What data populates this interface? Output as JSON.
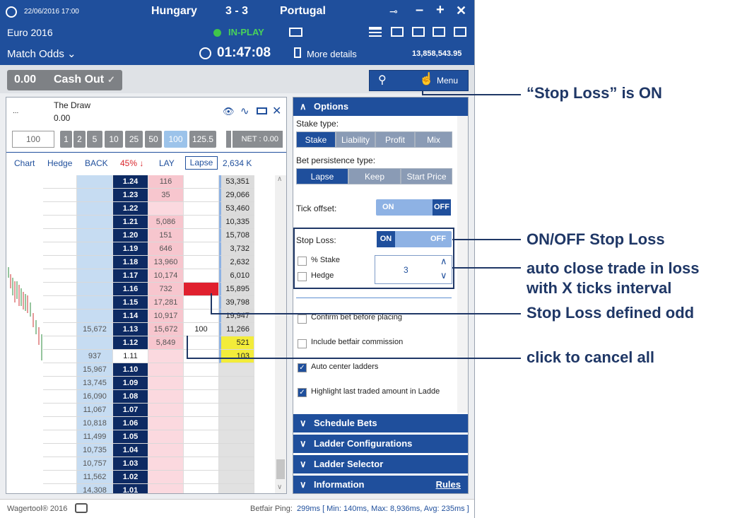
{
  "header": {
    "datetime": "22/06/2016 17:00",
    "home": "Hungary",
    "score": "3 - 3",
    "away": "Portugal",
    "competition": "Euro 2016",
    "status": "IN-PLAY",
    "market": "Match Odds",
    "clock": "01:47:08",
    "more_details": "More details",
    "matched": "13,858,543.95"
  },
  "cashout": {
    "value": "0.00",
    "label": "Cash Out",
    "check": "✓"
  },
  "menu": {
    "label": "Menu"
  },
  "runner": {
    "prefix": "...",
    "name": "The Draw",
    "pl": "0.00",
    "stake_input": "100",
    "stakes": [
      "1",
      "2",
      "5",
      "10",
      "25",
      "50",
      "100",
      "125.5"
    ],
    "net": "NET : 0.00"
  },
  "columns": {
    "chart": "Chart",
    "hedge": "Hedge",
    "back": "BACK",
    "pct": "45% ↓",
    "lay": "LAY",
    "lapse": "Lapse",
    "volume": "2,634 K"
  },
  "ladder": [
    {
      "price": "1.24",
      "layv": "116",
      "traded": "53,351"
    },
    {
      "price": "1.23",
      "layv": "35",
      "traded": "29,066"
    },
    {
      "price": "1.22",
      "layv": "",
      "traded": "53,460"
    },
    {
      "price": "1.21",
      "layv": "5,086",
      "traded": "10,335"
    },
    {
      "price": "1.20",
      "layv": "151",
      "traded": "15,708"
    },
    {
      "price": "1.19",
      "layv": "646",
      "traded": "3,732"
    },
    {
      "price": "1.18",
      "layv": "13,960",
      "traded": "2,632"
    },
    {
      "price": "1.17",
      "layv": "10,174",
      "traded": "6,010"
    },
    {
      "price": "1.16",
      "layv": "732",
      "traded": "15,895"
    },
    {
      "price": "1.15",
      "layv": "17,281",
      "traded": "39,798"
    },
    {
      "price": "1.14",
      "layv": "10,917",
      "traded": "19,947"
    },
    {
      "price": "1.13",
      "layv": "15,672",
      "backv": "15,672",
      "myorder": "100",
      "traded": "11,266"
    },
    {
      "price": "1.12",
      "layv": "5,849",
      "traded": "521"
    },
    {
      "price": "1.11",
      "backv": "937",
      "traded": "103"
    },
    {
      "price": "1.10",
      "backv": "15,967"
    },
    {
      "price": "1.09",
      "backv": "13,745"
    },
    {
      "price": "1.08",
      "backv": "16,090"
    },
    {
      "price": "1.07",
      "backv": "11,067"
    },
    {
      "price": "1.06",
      "backv": "10,818"
    },
    {
      "price": "1.05",
      "backv": "11,499"
    },
    {
      "price": "1.04",
      "backv": "10,735"
    },
    {
      "price": "1.03",
      "backv": "10,757"
    },
    {
      "price": "1.02",
      "backv": "11,562"
    },
    {
      "price": "1.01",
      "backv": "14,308"
    }
  ],
  "options": {
    "title": "Options",
    "stake_type": "Stake type:",
    "stake_types": [
      "Stake",
      "Liability",
      "Profit",
      "Mix"
    ],
    "persistence": "Bet persistence type:",
    "persistence_types": [
      "Lapse",
      "Keep",
      "Start Price"
    ],
    "tick_offset": "Tick offset:",
    "on": "ON",
    "off": "OFF",
    "stop_loss": "Stop Loss:",
    "pct_stake": "% Stake",
    "hedge": "Hedge",
    "ticks": "3",
    "confirm": "Confirm bet before placing",
    "commission": "Include betfair commission",
    "autocenter": "Auto center ladders",
    "highlight": "Highlight last traded amount in Ladde"
  },
  "sections": [
    "Schedule Bets",
    "Ladder Configurations",
    "Ladder Selector",
    "Information"
  ],
  "rules": "Rules",
  "footer": {
    "brand": "Wagertool® 2016",
    "ping_label": "Betfair Ping:",
    "ping": "299ms [ Min: 140ms, Max: 8,936ms, Avg: 235ms ]"
  },
  "annotations": {
    "a1": "“Stop Loss” is ON",
    "a2": "ON/OFF Stop Loss",
    "a3": "auto close trade in loss",
    "a3b": "with X ticks interval",
    "a4": "Stop Loss defined odd",
    "a5": "click to cancel all"
  }
}
